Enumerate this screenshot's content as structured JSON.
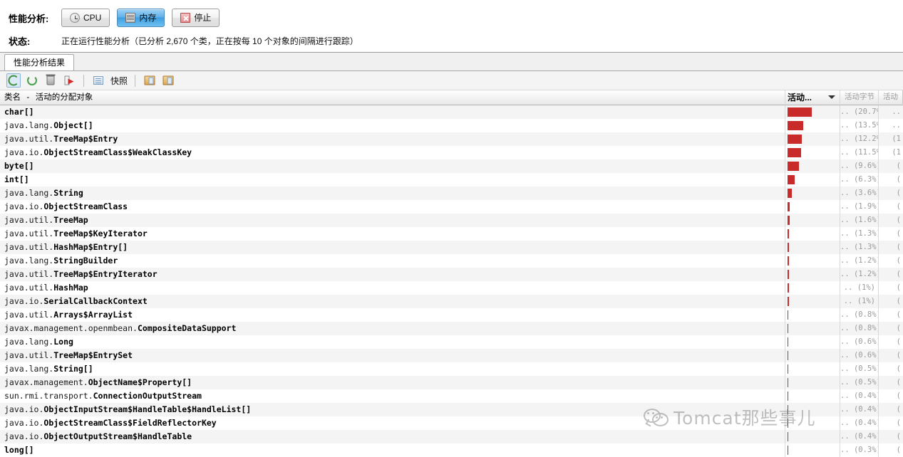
{
  "top_panel": {
    "profiler_label": "性能分析:",
    "status_label": "状态:",
    "status_text": "正在运行性能分析（已分析 2,670 个类，正在按每 10 个对象的间隔进行跟踪）",
    "buttons": [
      {
        "label": "CPU",
        "icon": "clock-icon",
        "selected": false
      },
      {
        "label": "内存",
        "icon": "memory-chip-icon",
        "selected": true
      },
      {
        "label": "停止",
        "icon": "stop-x-icon",
        "selected": false
      }
    ]
  },
  "tab": {
    "label": "性能分析结果"
  },
  "toolbar": {
    "items": [
      {
        "name": "refresh-results-button",
        "icon": "refresh-icon",
        "active": true
      },
      {
        "name": "auto-refresh-button",
        "icon": "refresh-cycle-icon",
        "active": false
      },
      {
        "name": "reset-collected-results-button",
        "icon": "trash-icon",
        "active": false
      },
      {
        "name": "export-results-button",
        "icon": "export-arrow-icon",
        "active": false
      },
      {
        "name": "take-snapshot-button",
        "icon": "snapshot-icon",
        "active": false
      }
    ],
    "snapshot_label": "快照",
    "extra_items": [
      {
        "name": "load-snapshot-button",
        "icon": "open-folder-image-icon"
      },
      {
        "name": "save-snapshot-button",
        "icon": "save-folder-image-icon"
      }
    ]
  },
  "table": {
    "columns": [
      {
        "key": "name",
        "label": "类名 - 活动的分配对象",
        "sorted": false
      },
      {
        "key": "live_objects",
        "label": "活动...",
        "sorted": true,
        "sort_dir": "desc"
      },
      {
        "key": "live_bytes",
        "label": "活动字节",
        "sorted": false
      },
      {
        "key": "live_trunc",
        "label": "活动",
        "sorted": false
      }
    ],
    "rows": [
      {
        "package": "",
        "class": "char[]",
        "percent": 20.7,
        "bar_pct": 100,
        "bytes": "..",
        "last": ".."
      },
      {
        "package": "java.lang.",
        "class": "Object[]",
        "percent": 13.5,
        "bar_pct": 52,
        "bytes": "..",
        "last": ".."
      },
      {
        "package": "java.util.",
        "class": "TreeMap$Entry",
        "percent": 12.2,
        "bar_pct": 62,
        "bytes": "..",
        "last": "(1"
      },
      {
        "package": "java.io.",
        "class": "ObjectStreamClass$WeakClassKey",
        "percent": 11.5,
        "bar_pct": 48,
        "bytes": "..",
        "last": "(1"
      },
      {
        "package": "",
        "class": "byte[]",
        "percent": 9.6,
        "bar_pct": 44,
        "bytes": "..",
        "last": "("
      },
      {
        "package": "",
        "class": "int[]",
        "percent": 6.3,
        "bar_pct": 24,
        "bytes": "..",
        "last": "("
      },
      {
        "package": "java.lang.",
        "class": "String",
        "percent": 3.6,
        "bar_pct": 22,
        "bytes": "..",
        "last": "("
      },
      {
        "package": "java.io.",
        "class": "ObjectStreamClass",
        "percent": 1.9,
        "bar_pct": 7,
        "bytes": "..",
        "last": "("
      },
      {
        "package": "java.util.",
        "class": "TreeMap",
        "percent": 1.6,
        "bar_pct": 7,
        "bytes": "..",
        "last": "("
      },
      {
        "package": "java.util.",
        "class": "TreeMap$KeyIterator",
        "percent": 1.3,
        "bar_pct": 7,
        "bytes": "..",
        "last": "("
      },
      {
        "package": "java.util.",
        "class": "HashMap$Entry[]",
        "percent": 1.3,
        "bar_pct": 7,
        "bytes": "..",
        "last": "("
      },
      {
        "package": "java.lang.",
        "class": "StringBuilder",
        "percent": 1.2,
        "bar_pct": 7,
        "bytes": "..",
        "last": "("
      },
      {
        "package": "java.util.",
        "class": "TreeMap$EntryIterator",
        "percent": 1.2,
        "bar_pct": 7,
        "bytes": "..",
        "last": "("
      },
      {
        "package": "java.util.",
        "class": "HashMap",
        "percent": 1.0,
        "bar_pct": 7,
        "bytes": "..",
        "last": "("
      },
      {
        "package": "java.io.",
        "class": "SerialCallbackContext",
        "percent": 1.0,
        "bar_pct": 7,
        "bytes": "..",
        "last": "("
      },
      {
        "package": "java.util.",
        "class": "Arrays$ArrayList",
        "percent": 0.8,
        "bar_pct": 7,
        "bytes": "..",
        "last": "("
      },
      {
        "package": "javax.management.openmbean.",
        "class": "CompositeDataSupport",
        "percent": 0.8,
        "bar_pct": 7,
        "bytes": "..",
        "last": "("
      },
      {
        "package": "java.lang.",
        "class": "Long",
        "percent": 0.6,
        "bar_pct": 0,
        "bytes": "..",
        "last": "("
      },
      {
        "package": "java.util.",
        "class": "TreeMap$EntrySet",
        "percent": 0.6,
        "bar_pct": 0,
        "bytes": "..",
        "last": "("
      },
      {
        "package": "java.lang.",
        "class": "String[]",
        "percent": 0.5,
        "bar_pct": 0,
        "bytes": "..",
        "last": "("
      },
      {
        "package": "javax.management.",
        "class": "ObjectName$Property[]",
        "percent": 0.5,
        "bar_pct": 0,
        "bytes": "..",
        "last": "("
      },
      {
        "package": "sun.rmi.transport.",
        "class": "ConnectionOutputStream",
        "percent": 0.4,
        "bar_pct": 0,
        "bytes": "..",
        "last": "("
      },
      {
        "package": "java.io.",
        "class": "ObjectInputStream$HandleTable$HandleList[]",
        "percent": 0.4,
        "bar_pct": 0,
        "bytes": "..",
        "last": "("
      },
      {
        "package": "java.io.",
        "class": "ObjectStreamClass$FieldReflectorKey",
        "percent": 0.4,
        "bar_pct": 0,
        "bytes": "..",
        "last": "("
      },
      {
        "package": "java.io.",
        "class": "ObjectOutputStream$HandleTable",
        "percent": 0.4,
        "bar_pct": 0,
        "bytes": "..",
        "last": "("
      },
      {
        "package": "",
        "class": "long[]",
        "percent": 0.3,
        "bar_pct": 0,
        "bytes": "..",
        "last": "("
      }
    ]
  },
  "watermark": {
    "text": "Tomcat那些事儿",
    "logo": "wechat-icon"
  },
  "colors": {
    "bar": "#c92b2b",
    "selected_button": "#3e9fe3",
    "accent_border": "#4e8bbd"
  }
}
